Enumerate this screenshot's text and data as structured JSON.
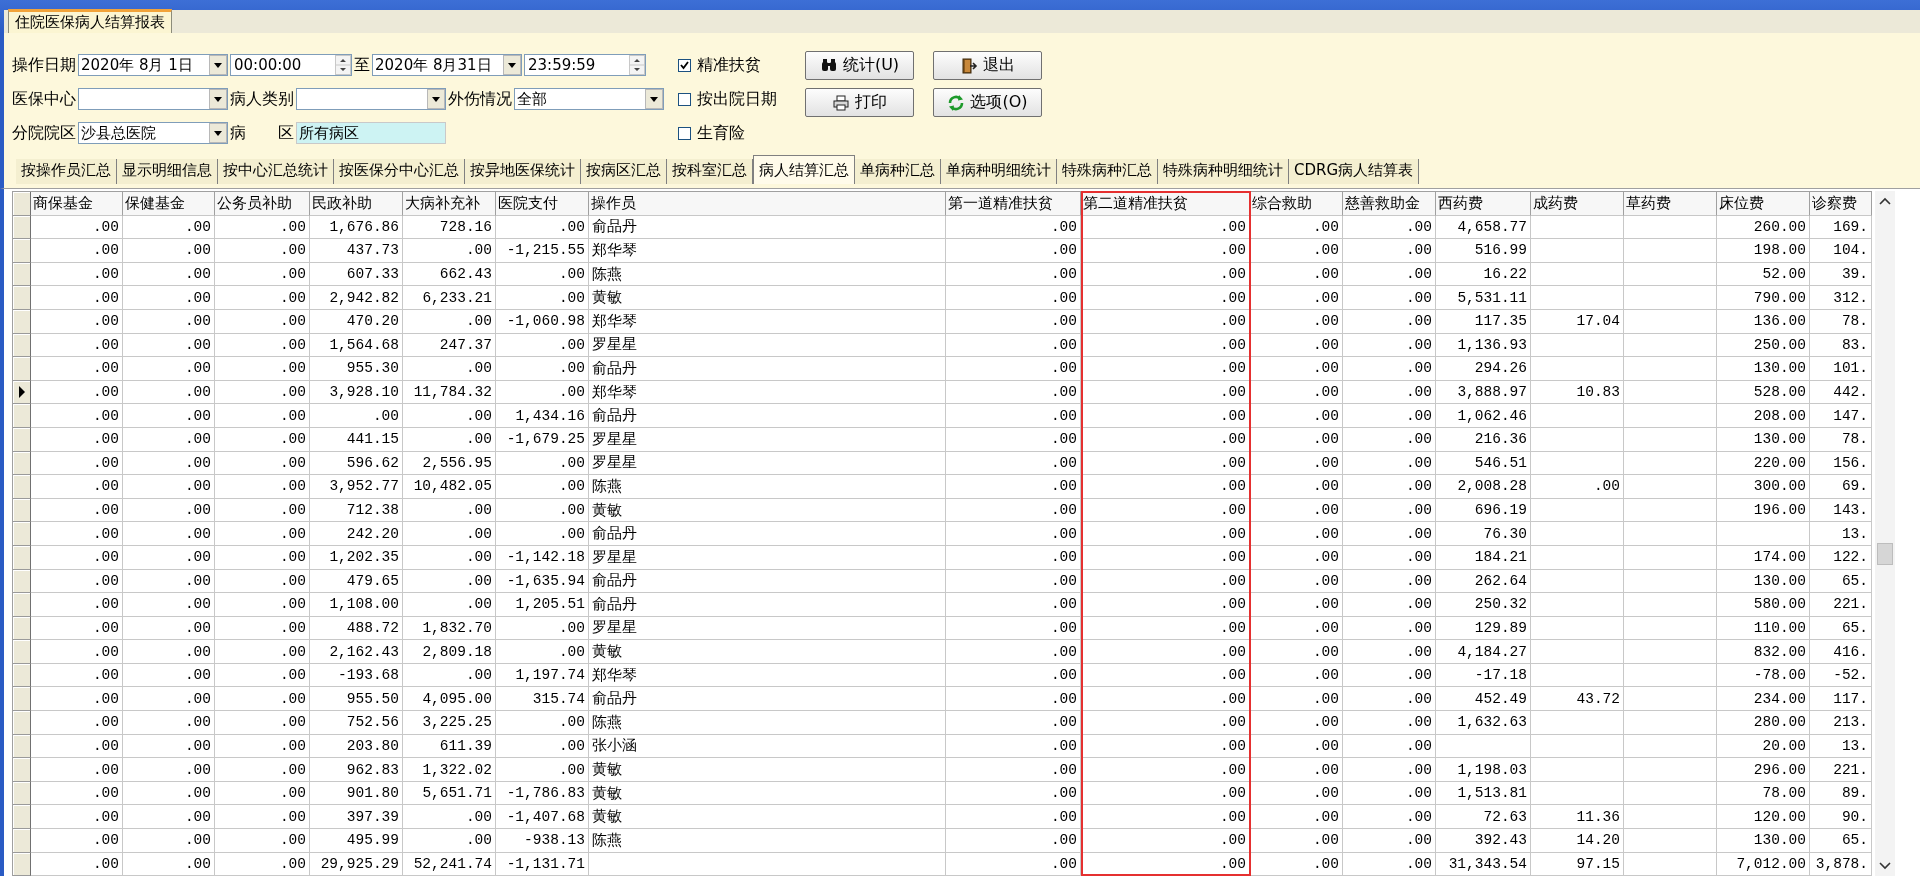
{
  "window": {
    "tab": "住院医保病人结算报表"
  },
  "filters": {
    "fields": [
      [
        {
          "kind": "label",
          "text": "操作日期"
        },
        {
          "kind": "combo",
          "value": "2020年 8月 1日"
        },
        {
          "kind": "spinner",
          "value": "00:00:00"
        },
        {
          "kind": "label",
          "text": "至"
        },
        {
          "kind": "combo",
          "value": "2020年 8月31日"
        },
        {
          "kind": "spinner",
          "value": "23:59:59"
        }
      ],
      [
        {
          "kind": "label",
          "text": "医保中心"
        },
        {
          "kind": "combo"
        },
        {
          "kind": "label",
          "text": "病人类别"
        },
        {
          "kind": "combo"
        },
        {
          "kind": "label",
          "text": "外伤情况"
        },
        {
          "kind": "combo",
          "value": "全部"
        }
      ],
      [
        {
          "kind": "label",
          "text": "分院院区"
        },
        {
          "kind": "combo",
          "value": "沙县总医院"
        },
        {
          "kind": "label",
          "text": "病"
        },
        {
          "kind": "label",
          "text": "区"
        },
        {
          "kind": "text",
          "value": "所有病区"
        }
      ]
    ],
    "checkboxes": [
      {
        "label": "精准扶贫",
        "checked": true
      },
      {
        "label": "按出院日期",
        "checked": false
      },
      {
        "label": "生育险",
        "checked": false
      }
    ],
    "buttons": [
      {
        "label": "统计(U)",
        "kind": "binoculars"
      },
      {
        "label": "退出",
        "kind": "exit"
      },
      {
        "label": "打印",
        "kind": "printer"
      },
      {
        "label": "选项(O)",
        "kind": "refresh"
      }
    ]
  },
  "tabs": [
    {
      "label": "按操作员汇总",
      "selected": false
    },
    {
      "label": "显示明细信息",
      "selected": false
    },
    {
      "label": "按中心汇总统计",
      "selected": false
    },
    {
      "label": "按医保分中心汇总",
      "selected": false
    },
    {
      "label": "按异地医保统计",
      "selected": false
    },
    {
      "label": "按病区汇总",
      "selected": false
    },
    {
      "label": "按科室汇总",
      "selected": false
    },
    {
      "label": "病人结算汇总",
      "selected": true
    },
    {
      "label": "单病种汇总",
      "selected": false
    },
    {
      "label": "单病种明细统计",
      "selected": false
    },
    {
      "label": "特殊病种汇总",
      "selected": false
    },
    {
      "label": "特殊病种明细统计",
      "selected": false
    },
    {
      "label": "CDRG病人结算表",
      "selected": false
    }
  ],
  "table": {
    "columns": [
      {
        "title": "商保基金",
        "kind": "number",
        "highlighted": false
      },
      {
        "title": "保健基金",
        "kind": "number",
        "highlighted": false
      },
      {
        "title": "公务员补助",
        "kind": "number",
        "highlighted": false
      },
      {
        "title": "民政补助",
        "kind": "number",
        "highlighted": false
      },
      {
        "title": "大病补充补",
        "kind": "number",
        "highlighted": false
      },
      {
        "title": "医院支付",
        "kind": "number",
        "highlighted": false
      },
      {
        "title": "操作员",
        "kind": "text",
        "highlighted": false
      },
      {
        "title": "第一道精准扶贫",
        "kind": "number",
        "highlighted": false
      },
      {
        "title": "第二道精准扶贫",
        "kind": "number",
        "highlighted": true
      },
      {
        "title": "综合救助",
        "kind": "number",
        "highlighted": false
      },
      {
        "title": "慈善救助金",
        "kind": "number",
        "highlighted": false
      },
      {
        "title": "西药费",
        "kind": "number",
        "highlighted": false
      },
      {
        "title": "成药费",
        "kind": "number",
        "highlighted": false
      },
      {
        "title": "草药费",
        "kind": "number",
        "highlighted": false
      },
      {
        "title": "床位费",
        "kind": "number",
        "highlighted": false
      },
      {
        "title": "诊察费",
        "kind": "number",
        "highlighted": false
      }
    ],
    "rows": [
      {
        "current": false,
        "cells": [
          ".00",
          ".00",
          ".00",
          "1,676.86",
          "728.16",
          ".00",
          "俞品丹",
          ".00",
          ".00",
          ".00",
          ".00",
          "4,658.77",
          null,
          null,
          "260.00",
          "169."
        ]
      },
      {
        "current": false,
        "cells": [
          ".00",
          ".00",
          ".00",
          "437.73",
          ".00",
          "-1,215.55",
          "郑华琴",
          ".00",
          ".00",
          ".00",
          ".00",
          "516.99",
          null,
          null,
          "198.00",
          "104."
        ]
      },
      {
        "current": false,
        "cells": [
          ".00",
          ".00",
          ".00",
          "607.33",
          "662.43",
          ".00",
          "陈燕",
          ".00",
          ".00",
          ".00",
          ".00",
          "16.22",
          null,
          null,
          "52.00",
          "39."
        ]
      },
      {
        "current": false,
        "cells": [
          ".00",
          ".00",
          ".00",
          "2,942.82",
          "6,233.21",
          ".00",
          "黄敏",
          ".00",
          ".00",
          ".00",
          ".00",
          "5,531.11",
          null,
          null,
          "790.00",
          "312."
        ]
      },
      {
        "current": false,
        "cells": [
          ".00",
          ".00",
          ".00",
          "470.20",
          ".00",
          "-1,060.98",
          "郑华琴",
          ".00",
          ".00",
          ".00",
          ".00",
          "117.35",
          "17.04",
          null,
          "136.00",
          "78."
        ]
      },
      {
        "current": false,
        "cells": [
          ".00",
          ".00",
          ".00",
          "1,564.68",
          "247.37",
          ".00",
          "罗星星",
          ".00",
          ".00",
          ".00",
          ".00",
          "1,136.93",
          null,
          null,
          "250.00",
          "83."
        ]
      },
      {
        "current": false,
        "cells": [
          ".00",
          ".00",
          ".00",
          "955.30",
          ".00",
          ".00",
          "俞品丹",
          ".00",
          ".00",
          ".00",
          ".00",
          "294.26",
          null,
          null,
          "130.00",
          "101."
        ]
      },
      {
        "current": true,
        "cells": [
          ".00",
          ".00",
          ".00",
          "3,928.10",
          "11,784.32",
          ".00",
          "郑华琴",
          ".00",
          ".00",
          ".00",
          ".00",
          "3,888.97",
          "10.83",
          null,
          "528.00",
          "442."
        ]
      },
      {
        "current": false,
        "cells": [
          ".00",
          ".00",
          ".00",
          ".00",
          ".00",
          "1,434.16",
          "俞品丹",
          ".00",
          ".00",
          ".00",
          ".00",
          "1,062.46",
          null,
          null,
          "208.00",
          "147."
        ]
      },
      {
        "current": false,
        "cells": [
          ".00",
          ".00",
          ".00",
          "441.15",
          ".00",
          "-1,679.25",
          "罗星星",
          ".00",
          ".00",
          ".00",
          ".00",
          "216.36",
          null,
          null,
          "130.00",
          "78."
        ]
      },
      {
        "current": false,
        "cells": [
          ".00",
          ".00",
          ".00",
          "596.62",
          "2,556.95",
          ".00",
          "罗星星",
          ".00",
          ".00",
          ".00",
          ".00",
          "546.51",
          null,
          null,
          "220.00",
          "156."
        ]
      },
      {
        "current": false,
        "cells": [
          ".00",
          ".00",
          ".00",
          "3,952.77",
          "10,482.05",
          ".00",
          "陈燕",
          ".00",
          ".00",
          ".00",
          ".00",
          "2,008.28",
          ".00",
          null,
          "300.00",
          "69."
        ]
      },
      {
        "current": false,
        "cells": [
          ".00",
          ".00",
          ".00",
          "712.38",
          ".00",
          ".00",
          "黄敏",
          ".00",
          ".00",
          ".00",
          ".00",
          "696.19",
          null,
          null,
          "196.00",
          "143."
        ]
      },
      {
        "current": false,
        "cells": [
          ".00",
          ".00",
          ".00",
          "242.20",
          ".00",
          ".00",
          "俞品丹",
          ".00",
          ".00",
          ".00",
          ".00",
          "76.30",
          null,
          null,
          null,
          "13."
        ]
      },
      {
        "current": false,
        "cells": [
          ".00",
          ".00",
          ".00",
          "1,202.35",
          ".00",
          "-1,142.18",
          "罗星星",
          ".00",
          ".00",
          ".00",
          ".00",
          "184.21",
          null,
          null,
          "174.00",
          "122."
        ]
      },
      {
        "current": false,
        "cells": [
          ".00",
          ".00",
          ".00",
          "479.65",
          ".00",
          "-1,635.94",
          "俞品丹",
          ".00",
          ".00",
          ".00",
          ".00",
          "262.64",
          null,
          null,
          "130.00",
          "65."
        ]
      },
      {
        "current": false,
        "cells": [
          ".00",
          ".00",
          ".00",
          "1,108.00",
          ".00",
          "1,205.51",
          "俞品丹",
          ".00",
          ".00",
          ".00",
          ".00",
          "250.32",
          null,
          null,
          "580.00",
          "221."
        ]
      },
      {
        "current": false,
        "cells": [
          ".00",
          ".00",
          ".00",
          "488.72",
          "1,832.70",
          ".00",
          "罗星星",
          ".00",
          ".00",
          ".00",
          ".00",
          "129.89",
          null,
          null,
          "110.00",
          "65."
        ]
      },
      {
        "current": false,
        "cells": [
          ".00",
          ".00",
          ".00",
          "2,162.43",
          "2,809.18",
          ".00",
          "黄敏",
          ".00",
          ".00",
          ".00",
          ".00",
          "4,184.27",
          null,
          null,
          "832.00",
          "416."
        ]
      },
      {
        "current": false,
        "cells": [
          ".00",
          ".00",
          ".00",
          "-193.68",
          ".00",
          "1,197.74",
          "郑华琴",
          ".00",
          ".00",
          ".00",
          ".00",
          "-17.18",
          null,
          null,
          "-78.00",
          "-52."
        ]
      },
      {
        "current": false,
        "cells": [
          ".00",
          ".00",
          ".00",
          "955.50",
          "4,095.00",
          "315.74",
          "俞品丹",
          ".00",
          ".00",
          ".00",
          ".00",
          "452.49",
          "43.72",
          null,
          "234.00",
          "117."
        ]
      },
      {
        "current": false,
        "cells": [
          ".00",
          ".00",
          ".00",
          "752.56",
          "3,225.25",
          ".00",
          "陈燕",
          ".00",
          ".00",
          ".00",
          ".00",
          "1,632.63",
          null,
          null,
          "280.00",
          "213."
        ]
      },
      {
        "current": false,
        "cells": [
          ".00",
          ".00",
          ".00",
          "203.80",
          "611.39",
          ".00",
          "张小涵",
          ".00",
          ".00",
          ".00",
          ".00",
          null,
          null,
          null,
          "20.00",
          "13."
        ]
      },
      {
        "current": false,
        "cells": [
          ".00",
          ".00",
          ".00",
          "962.83",
          "1,322.02",
          ".00",
          "黄敏",
          ".00",
          ".00",
          ".00",
          ".00",
          "1,198.03",
          null,
          null,
          "296.00",
          "221."
        ]
      },
      {
        "current": false,
        "cells": [
          ".00",
          ".00",
          ".00",
          "901.80",
          "5,651.71",
          "-1,786.83",
          "黄敏",
          ".00",
          ".00",
          ".00",
          ".00",
          "1,513.81",
          null,
          null,
          "78.00",
          "89."
        ]
      },
      {
        "current": false,
        "cells": [
          ".00",
          ".00",
          ".00",
          "397.39",
          ".00",
          "-1,407.68",
          "黄敏",
          ".00",
          ".00",
          ".00",
          ".00",
          "72.63",
          "11.36",
          null,
          "120.00",
          "90."
        ]
      },
      {
        "current": false,
        "cells": [
          ".00",
          ".00",
          ".00",
          "495.99",
          ".00",
          "-938.13",
          "陈燕",
          ".00",
          ".00",
          ".00",
          ".00",
          "392.43",
          "14.20",
          null,
          "130.00",
          "65."
        ]
      },
      {
        "current": false,
        "cells": [
          ".00",
          ".00",
          ".00",
          "29,925.29",
          "52,241.74",
          "-1,131.71",
          null,
          ".00",
          ".00",
          ".00",
          ".00",
          "31,343.54",
          "97.15",
          null,
          "7,012.00",
          "3,878."
        ]
      }
    ]
  }
}
